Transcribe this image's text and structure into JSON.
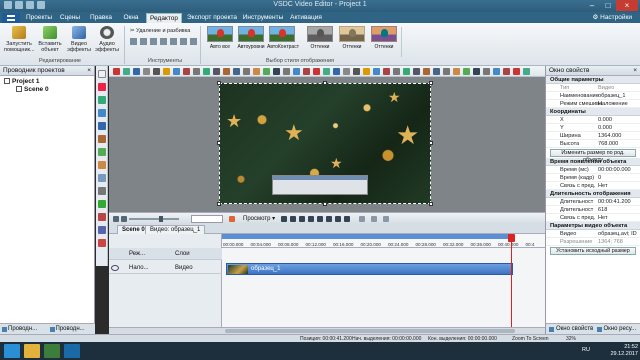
{
  "window": {
    "title": "VSDC Video Editor - Project 1"
  },
  "menu": {
    "file_label": "",
    "tabs": [
      "Проекты",
      "Сцены",
      "Правка",
      "Окна",
      "Редактор",
      "Экспорт проекта",
      "Инструменты",
      "Активация"
    ],
    "active_tab": "Редактор",
    "settings_label": "Настройки"
  },
  "ribbon": {
    "run_assistant": "Запустить помощник...",
    "insert_object": "Вставить объект",
    "video_effects": "Видео эффекты",
    "audio_effects": "Аудио эффекты",
    "group_editing": "Редактирование",
    "delete_split": "Удаление и разбивка",
    "group_tools": "Инструменты",
    "styles": [
      "Авто все",
      "Автоуровни",
      "АвтоКонтраст",
      "Оттенки",
      "Оттенки",
      "Оттенки"
    ],
    "group_styles": "Выбор стиля отображения"
  },
  "left_panel": {
    "title": "Проводник проектов",
    "tree": [
      "Project 1",
      "Scene 0"
    ],
    "tabs": [
      "Проводн...",
      "Проводн..."
    ]
  },
  "player": {
    "preview_label": "Просмотр"
  },
  "timeline": {
    "tabs": [
      "Scene 0",
      "Видео: образец_1"
    ],
    "header_col1": "Реж...",
    "header_col2": "Слои",
    "track_blend": "Нало...",
    "track_name": "Видео",
    "clip_label": "образец_1",
    "ruler_ticks": [
      "00:00.000",
      "00:04.000",
      "00:08.000",
      "00:12.000",
      "00:16.000",
      "00:20.000",
      "00:24.000",
      "00:28.000",
      "00:32.000",
      "00:36.000",
      "00:40.000",
      "00:4"
    ]
  },
  "right_panel": {
    "title": "Окно свойств",
    "sections": {
      "general": "Общие параметры",
      "coords": "Координаты",
      "appear": "Время появления объекта",
      "duration": "Длительность отображения",
      "video_params": "Параметры видео объекта"
    },
    "props": [
      {
        "k": "Тип",
        "v": "Видео",
        "gray": true
      },
      {
        "k": "Наименование",
        "v": "образец_1",
        "gray": false
      },
      {
        "k": "Режим смешива",
        "v": "Наложение",
        "gray": false
      }
    ],
    "coords": [
      {
        "k": "X",
        "v": "0.000"
      },
      {
        "k": "Y",
        "v": "0.000"
      },
      {
        "k": "Ширина",
        "v": "1364.000"
      },
      {
        "k": "Высота",
        "v": "768.000"
      }
    ],
    "resize_button": "Изменить размер по род. объекту",
    "appear_props": [
      {
        "k": "Время (мс)",
        "v": "00:00:00.000"
      },
      {
        "k": "Время (кадр)",
        "v": "0"
      },
      {
        "k": "Связь с пред.",
        "v": "Нет"
      }
    ],
    "duration_props": [
      {
        "k": "Длительност",
        "v": "00:00:41.200"
      },
      {
        "k": "Длительност",
        "v": "618"
      },
      {
        "k": "Связь с пред.",
        "v": "Нет"
      }
    ],
    "video_props": [
      {
        "k": "Видео",
        "v": "образец.avi; ID",
        "gray": false
      },
      {
        "k": "Разрешение",
        "v": "1364; 768",
        "gray": true
      }
    ],
    "original_size_button": "Установить исходный размер",
    "tabs": [
      "Окно свойств",
      "Окно ресу..."
    ]
  },
  "status": {
    "position": "Позиция: 00:00:41.200",
    "sel_start": "Нач. выделения: 00:00:00.000",
    "sel_end": "Кон. выделения: 00:00:00.000",
    "zoom_label": "Zoom To Screen",
    "zoom_pct": "32%"
  },
  "taskbar": {
    "lang": "RU",
    "time": "21:52",
    "date": "29.12.2017"
  }
}
